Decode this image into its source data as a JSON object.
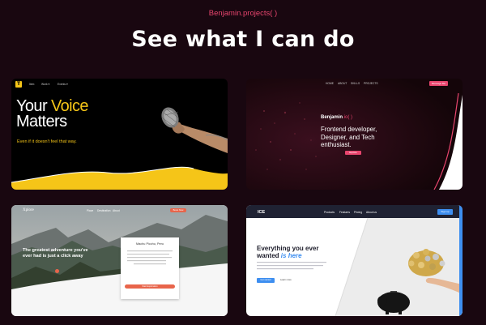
{
  "header": {
    "eyebrow": "Benjamin.projects( )",
    "title": "See what I can do"
  },
  "projects": [
    {
      "logo": "T",
      "nav": [
        "Item",
        "Work ▾",
        "Events ▾"
      ],
      "headline_line1_a": "Your",
      "headline_line1_b": "Voice",
      "headline_line2": "Matters",
      "subtitle": "Even if it doesn't feel that way.",
      "accent": "#f5c518"
    },
    {
      "nav": [
        "HOME",
        "ABOUT",
        "SKILLS",
        "PROJECTS"
      ],
      "nav_button": "Message Me",
      "name": "Benjamin",
      "name_suffix": ".io( )",
      "role_line1": "Frontend developer,",
      "role_line2": "Designer, and Tech",
      "role_line3": "enthusiast.",
      "cta": "Explore",
      "accent": "#e8456e"
    },
    {
      "brand": "Xplore",
      "nav": [
        "Place",
        "Destination",
        "About"
      ],
      "nav_button": "Book Now",
      "hero_line1": "The greatest adventure you've",
      "hero_line2": "ever had is just a click away",
      "panel_title": "Machu Picchu, Peru",
      "panel_button": "Start Exploration",
      "accent": "#e8654b"
    },
    {
      "brand": "ICE",
      "nav": [
        "Products",
        "Features",
        "Pricing",
        "About us"
      ],
      "nav_button": "Sign up",
      "hero_line1": "Everything you ever",
      "hero_line2a": "wanted",
      "hero_line2b": "is here",
      "primary_button": "Get started",
      "secondary_link": "Learn more",
      "accent": "#3d8ef0"
    }
  ]
}
